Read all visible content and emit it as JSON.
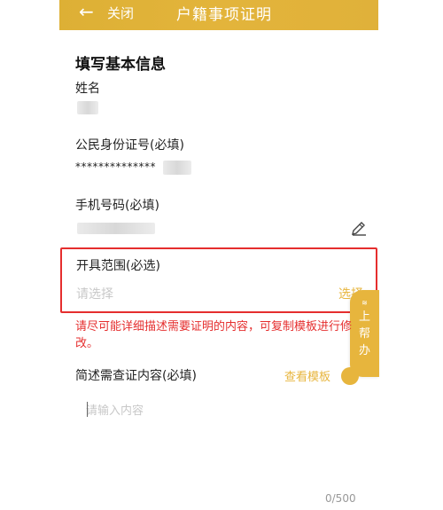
{
  "header": {
    "back_icon": "arrow-left-icon",
    "close_label": "关闭",
    "title": "户籍事项证明"
  },
  "form": {
    "section_title": "填写基本信息",
    "name": {
      "label": "姓名"
    },
    "id_card": {
      "label": "公民身份证号(必填)",
      "masked_value": "**************"
    },
    "phone": {
      "label": "手机号码(必填)",
      "edit_icon": "pencil-icon"
    },
    "scope": {
      "label": "开具范围(必选)",
      "placeholder": "请选择",
      "select_label": "选择"
    },
    "notice": "请尽可能详细描述需要证明的内容，可复制模板进行修改。",
    "description": {
      "label": "简述需查证内容(必填)",
      "template_link": "查看模板",
      "placeholder": "请输入内容",
      "char_count": "0/500"
    }
  },
  "float_help": {
    "lines": [
      "上",
      "帮",
      "办"
    ]
  },
  "colors": {
    "accent": "#e7b53d",
    "header": "#e0b13a",
    "error": "#e52e2e",
    "placeholder": "#c8c8c8"
  }
}
